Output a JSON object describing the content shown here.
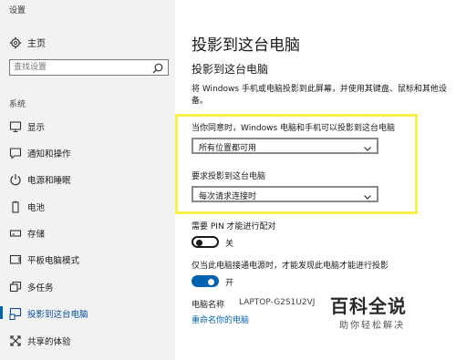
{
  "app": {
    "title": "设置"
  },
  "sidebar": {
    "home_label": "主页",
    "search_placeholder": "查找设置",
    "section_label": "系统",
    "items": [
      {
        "label": "显示",
        "icon": "monitor-icon"
      },
      {
        "label": "通知和操作",
        "icon": "notification-icon"
      },
      {
        "label": "电源和睡眠",
        "icon": "power-icon"
      },
      {
        "label": "电池",
        "icon": "battery-icon"
      },
      {
        "label": "存储",
        "icon": "storage-icon"
      },
      {
        "label": "平板电脑模式",
        "icon": "tablet-icon"
      },
      {
        "label": "多任务",
        "icon": "multitask-icon"
      },
      {
        "label": "投影到这台电脑",
        "icon": "project-icon",
        "active": true
      },
      {
        "label": "共享的体验",
        "icon": "share-icon"
      }
    ]
  },
  "main": {
    "page_title": "投影到这台电脑",
    "section_title": "投影到这台电脑",
    "description": "将 Windows 手机或电脑投影到此屏幕，并使用其键盘、鼠标和其他设备。",
    "setting1": {
      "label": "当你同意时，Windows 电脑和手机可以投影到这台电脑",
      "value": "所有位置都可用"
    },
    "setting2": {
      "label": "要求投影到这台电脑",
      "value": "每次请求连接时"
    },
    "pin": {
      "label": "需要 PIN 才能进行配对",
      "state": "关"
    },
    "power": {
      "label": "仅当此电脑接通电源时，才能发现此电脑才能进行投影",
      "state": "开"
    },
    "pc_name_label": "电脑名称",
    "pc_name_value": "LAPTOP-G2S1U2VJ",
    "rename_link": "重命名你的电脑"
  },
  "watermark": {
    "big": "百科全说",
    "small": "助你轻松解决"
  },
  "colors": {
    "accent": "#0063b1",
    "highlight": "#f5f04a",
    "sidebar_bg": "#f2f2f2"
  }
}
